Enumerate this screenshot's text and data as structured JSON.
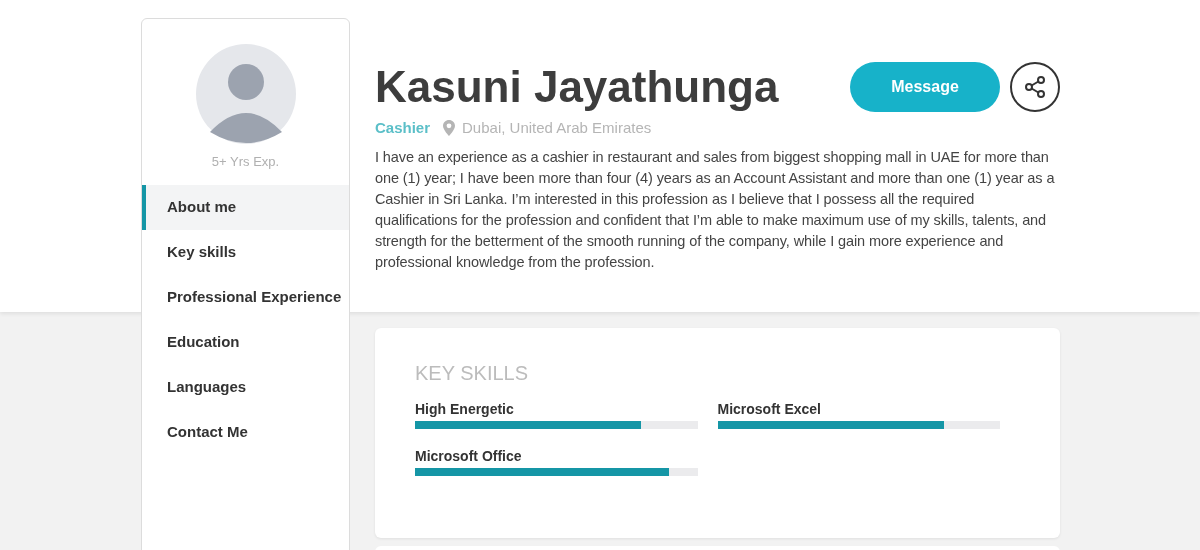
{
  "profile": {
    "name": "Kasuni Jayathunga",
    "role": "Cashier",
    "location": "Dubai, United Arab Emirates",
    "experience": "5+ Yrs Exp.",
    "about": "I have an experience as a cashier in restaurant and sales from biggest shopping mall in UAE for more than one (1) year; I have been more than four (4) years as an Account Assistant and more than one (1) year as a Cashier in Sri Lanka. I’m interested in this profession as I believe that I possess all the required qualifications for the profession and confident that I’m able to make maximum use of my skills, talents, and strength for the betterment of the smooth running of the company, while I gain more experience and professional knowledge from the profession."
  },
  "actions": {
    "message": "Message"
  },
  "sidebar": {
    "items": [
      {
        "label": "About me",
        "selected": true
      },
      {
        "label": "Key skills",
        "selected": false
      },
      {
        "label": "Professional Experience",
        "selected": false
      },
      {
        "label": "Education",
        "selected": false
      },
      {
        "label": "Languages",
        "selected": false
      },
      {
        "label": "Contact Me",
        "selected": false
      }
    ]
  },
  "key_skills": {
    "title": "KEY SKILLS",
    "skills": [
      {
        "name": "High Energetic",
        "level": 0.8
      },
      {
        "name": "Microsoft Excel",
        "level": 0.8
      },
      {
        "name": "Microsoft Office",
        "level": 0.9
      }
    ]
  }
}
